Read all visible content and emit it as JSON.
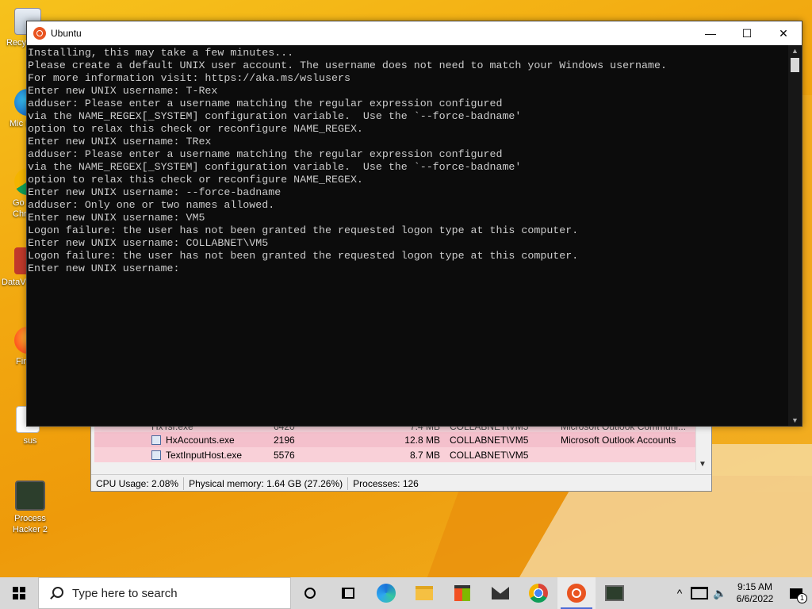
{
  "desktop": {
    "icons": [
      {
        "label": "Recy"
      },
      {
        "label": "Mic E"
      },
      {
        "label": "Go Chr"
      },
      {
        "label": "DataV"
      },
      {
        "label": "Fir"
      },
      {
        "label": "sus"
      },
      {
        "label": "Process Hacker 2"
      }
    ]
  },
  "terminal": {
    "title": "Ubuntu",
    "minimize": "—",
    "maximize": "☐",
    "close": "✕",
    "lines": [
      "Installing, this may take a few minutes...",
      "Please create a default UNIX user account. The username does not need to match your Windows username.",
      "For more information visit: https://aka.ms/wslusers",
      "Enter new UNIX username: T-Rex",
      "adduser: Please enter a username matching the regular expression configured",
      "via the NAME_REGEX[_SYSTEM] configuration variable.  Use the `--force-badname'",
      "option to relax this check or reconfigure NAME_REGEX.",
      "Enter new UNIX username: TRex",
      "adduser: Please enter a username matching the regular expression configured",
      "via the NAME_REGEX[_SYSTEM] configuration variable.  Use the `--force-badname'",
      "option to relax this check or reconfigure NAME_REGEX.",
      "Enter new UNIX username: --force-badname",
      "adduser: Only one or two names allowed.",
      "Enter new UNIX username: VM5",
      "Logon failure: the user has not been granted the requested logon type at this computer.",
      "Enter new UNIX username: COLLABNET\\VM5",
      "Logon failure: the user has not been granted the requested logon type at this computer.",
      "Enter new UNIX username: "
    ]
  },
  "process_hacker": {
    "rows": [
      {
        "name": "HxTsr.exe",
        "pid": "6420",
        "mem": "7.4 MB",
        "user": "COLLABNET\\VM5",
        "desc": "Microsoft Outlook Communi..."
      },
      {
        "name": "HxAccounts.exe",
        "pid": "2196",
        "mem": "12.8 MB",
        "user": "COLLABNET\\VM5",
        "desc": "Microsoft Outlook Accounts"
      },
      {
        "name": "TextInputHost.exe",
        "pid": "5576",
        "mem": "8.7 MB",
        "user": "COLLABNET\\VM5",
        "desc": ""
      }
    ],
    "status": {
      "cpu": "CPU Usage: 2.08%",
      "memory": "Physical memory: 1.64 GB (27.26%)",
      "processes": "Processes: 126"
    }
  },
  "taskbar": {
    "search_placeholder": "Type here to search",
    "pinned": [
      "task-view-icon",
      "timeline-icon",
      "edge-icon",
      "file-explorer-icon",
      "store-icon",
      "mail-icon",
      "chrome-icon",
      "ubuntu-icon",
      "process-hacker-icon"
    ],
    "time": "9:15 AM",
    "date": "6/6/2022",
    "notification_count": "1"
  }
}
